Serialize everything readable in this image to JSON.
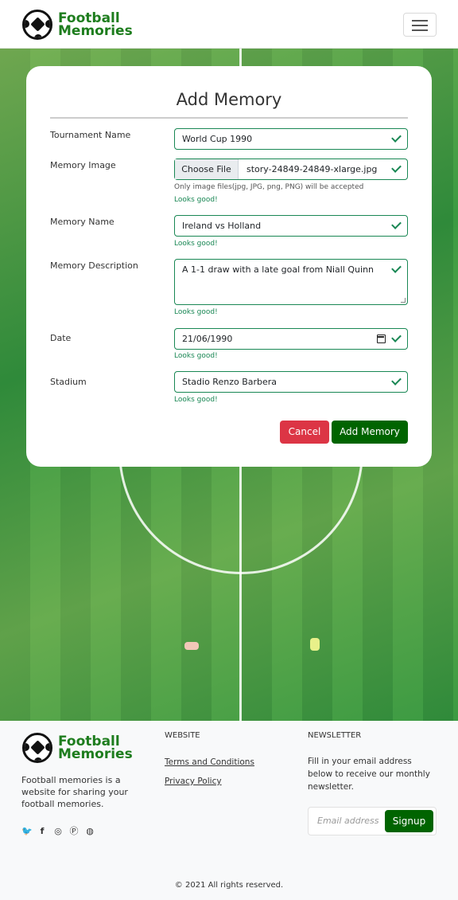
{
  "nav": {
    "brand_line1": "Football",
    "brand_line2": "Memories",
    "menu_icon": "hamburger-icon"
  },
  "form": {
    "title": "Add Memory",
    "tournament": {
      "label": "Tournament Name",
      "value": "World Cup 1990"
    },
    "image": {
      "label": "Memory Image",
      "button": "Choose File",
      "file": "story-24849-24849-xlarge.jpg",
      "hint": "Only image files(jpg, JPG, png, PNG) will be accepted",
      "feedback": "Looks good!"
    },
    "name": {
      "label": "Memory Name",
      "value": "Ireland vs Holland",
      "feedback": "Looks good!"
    },
    "description": {
      "label": "Memory Description",
      "value": "A 1-1 draw with a late goal from Niall Quinn",
      "feedback": "Looks good!"
    },
    "date": {
      "label": "Date",
      "value": "21/06/1990",
      "feedback": "Looks good!"
    },
    "stadium": {
      "label": "Stadium",
      "value": "Stadio Renzo Barbera",
      "feedback": "Looks good!"
    },
    "cancel": "Cancel",
    "submit": "Add Memory"
  },
  "footer": {
    "brand_line1": "Football",
    "brand_line2": "Memories",
    "about": "Football memories is a website for sharing your football memories.",
    "socials": [
      "twitter-icon",
      "facebook-icon",
      "instagram-icon",
      "pinterest-icon",
      "snapchat-icon"
    ],
    "website_heading": "WEBSITE",
    "links": [
      "Terms and Conditions",
      "Privacy Policy"
    ],
    "newsletter_heading": "NEWSLETTER",
    "newsletter_text": "Fill in your email address below to receive our monthly newsletter.",
    "email_placeholder": "Email address",
    "signup": "Signup",
    "copyright": "© 2021 All rights reserved."
  },
  "colors": {
    "primary": "#006400",
    "danger": "#dc3545",
    "valid": "#198754",
    "brand": "#1e7d1e"
  }
}
